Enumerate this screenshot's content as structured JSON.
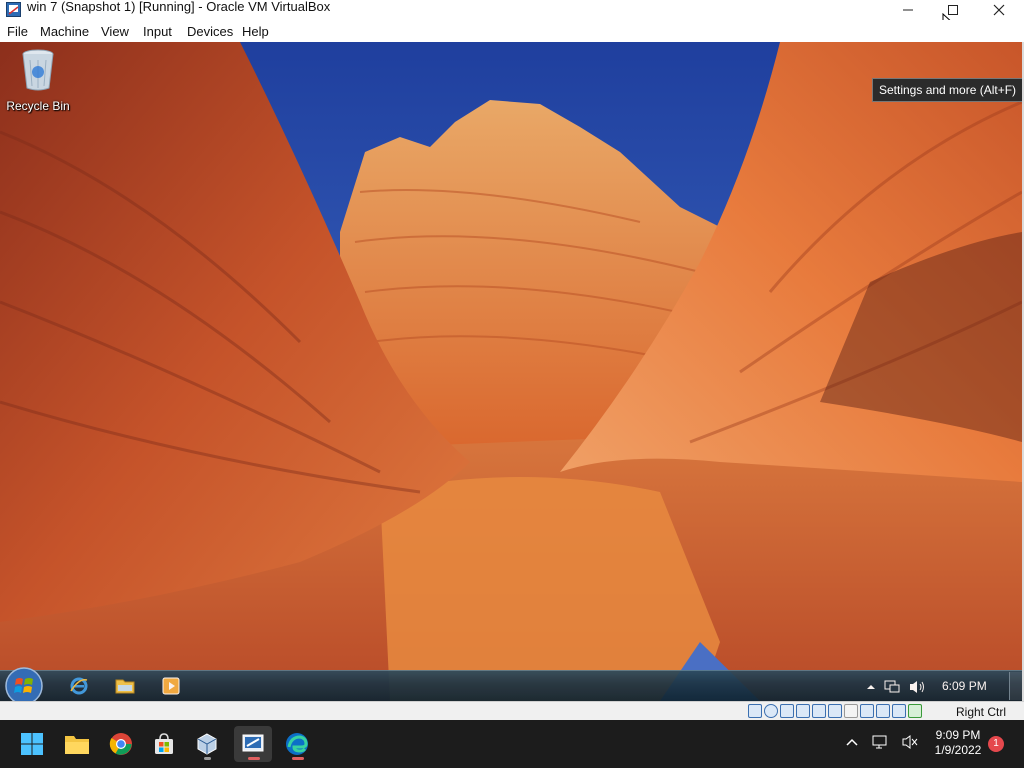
{
  "window": {
    "title": "win 7 (Snapshot 1) [Running] - Oracle VM VirtualBox",
    "controls": [
      "minimize-icon",
      "maximize-icon",
      "close-icon"
    ]
  },
  "menu": {
    "items": [
      "File",
      "Machine",
      "View",
      "Input",
      "Devices",
      "Help"
    ]
  },
  "guest": {
    "desktop_icons": [
      {
        "label": "Recycle Bin",
        "icon": "recycle-bin-icon"
      }
    ],
    "tooltip": "Settings and more (Alt+F)",
    "taskbar": {
      "pinned": [
        "internet-explorer-icon",
        "file-explorer-icon",
        "media-player-icon"
      ],
      "tray_icons": [
        "show-hidden-icons-icon",
        "network-icon",
        "volume-icon"
      ],
      "clock": "6:09 PM"
    }
  },
  "statusbar": {
    "host_key": "Right Ctrl",
    "icons": [
      "hard-disk-icon",
      "optical-drive-icon",
      "audio-icon",
      "network-adapter-icon",
      "usb-icon",
      "shared-folders-icon",
      "display-icon",
      "video-capture-icon",
      "cpu-icon",
      "mouse-integration-icon",
      "keyboard-capture-icon"
    ]
  },
  "host_taskbar": {
    "apps": [
      "start-icon",
      "file-explorer-icon",
      "chrome-icon",
      "microsoft-store-icon",
      "virtualbox-icon",
      "virtualbox-vm-icon",
      "edge-icon"
    ],
    "time": "9:09 PM",
    "date": "1/9/2022",
    "notification_count": "1"
  },
  "colors": {
    "win11_taskbar": "#1c1c1c",
    "sky": "#2f55b8",
    "rock": "#d9692d"
  }
}
